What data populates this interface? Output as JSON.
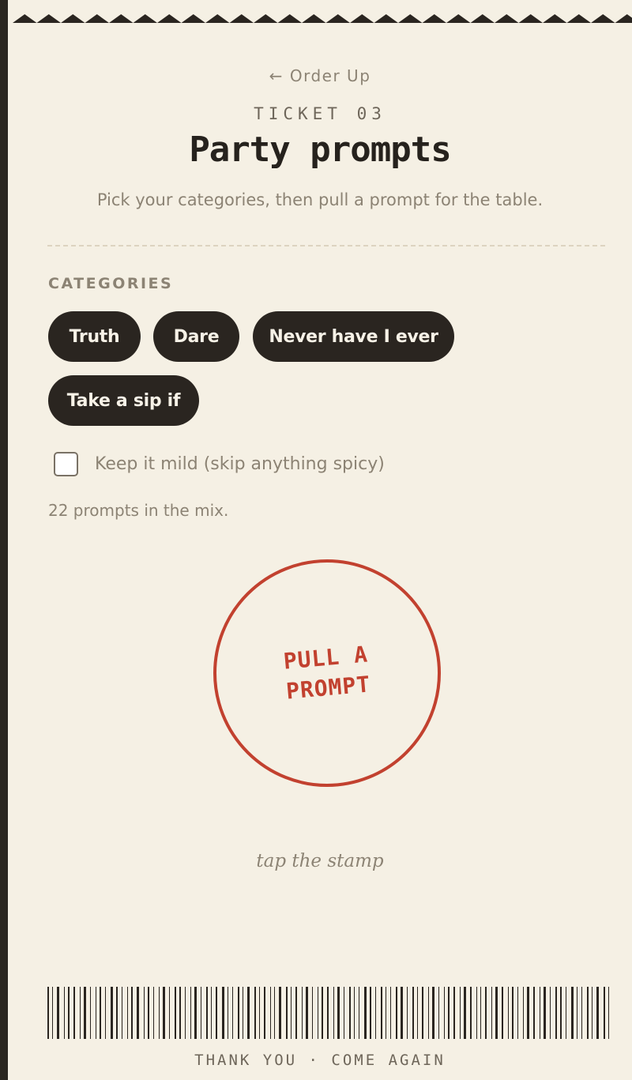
{
  "nav": {
    "back_arrow": "←",
    "back_label": "Order Up"
  },
  "header": {
    "ticket_label": "TICKET 03",
    "title": "Party prompts",
    "subtitle": "Pick your categories, then pull a prompt for the table."
  },
  "categories": {
    "heading": "CATEGORIES",
    "items": [
      {
        "label": "Truth",
        "selected": true
      },
      {
        "label": "Dare",
        "selected": true
      },
      {
        "label": "Never have I ever",
        "selected": true
      },
      {
        "label": "Take a sip if",
        "selected": true
      }
    ]
  },
  "mild": {
    "label": "Keep it mild (skip anything spicy)",
    "checked": false
  },
  "count_text": "22 prompts in the mix.",
  "stamp": {
    "line1": "PULL A",
    "line2": "PROMPT"
  },
  "hint": "tap the stamp",
  "footer": "THANK YOU · COME AGAIN",
  "colors": {
    "paper": "#f5f0e4",
    "ink": "#2a2520",
    "stamp_red": "#c2412f",
    "muted": "#8c8374",
    "frame": "#2a2620"
  },
  "icons": {
    "zigzag": "zigzag-edge-icon",
    "barcode": "barcode-icon",
    "back": "left-arrow-icon"
  }
}
